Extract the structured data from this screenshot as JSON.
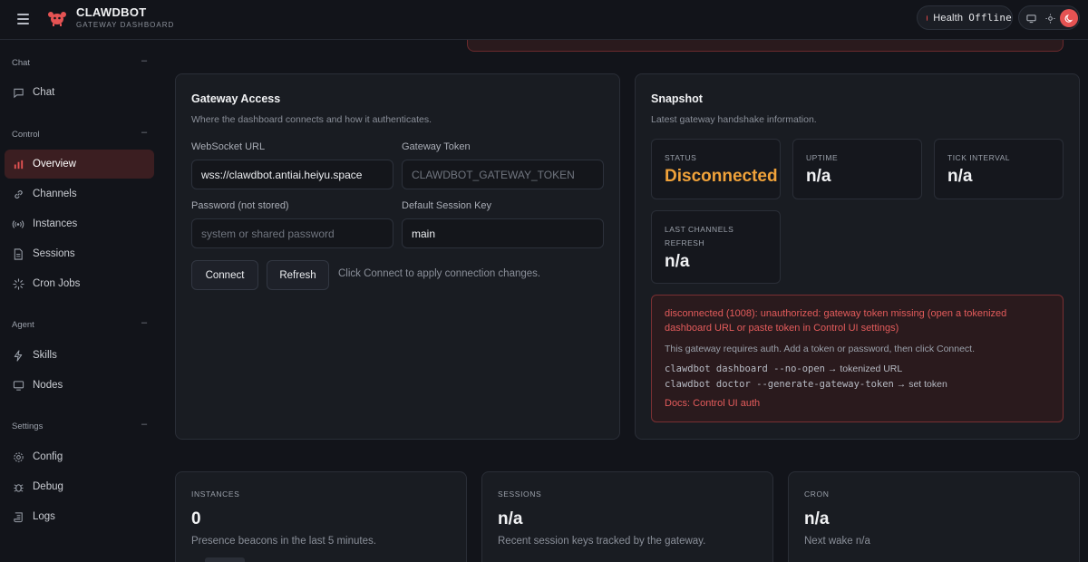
{
  "header": {
    "brand_title": "CLAWDBOT",
    "brand_subtitle": "GATEWAY DASHBOARD",
    "health_label": "Health",
    "health_status": "Offline",
    "accent_color": "#e55353"
  },
  "sidebar": {
    "groups": [
      {
        "label": "Chat",
        "toggle": "–",
        "items": [
          {
            "label": "Chat",
            "icon": "chat-bubble-icon"
          }
        ]
      },
      {
        "label": "Control",
        "toggle": "–",
        "items": [
          {
            "label": "Overview",
            "icon": "bar-chart-icon",
            "active": true
          },
          {
            "label": "Channels",
            "icon": "link-icon"
          },
          {
            "label": "Instances",
            "icon": "broadcast-icon"
          },
          {
            "label": "Sessions",
            "icon": "document-icon"
          },
          {
            "label": "Cron Jobs",
            "icon": "loader-icon"
          }
        ]
      },
      {
        "label": "Agent",
        "toggle": "–",
        "items": [
          {
            "label": "Skills",
            "icon": "bolt-icon"
          },
          {
            "label": "Nodes",
            "icon": "monitor-icon"
          }
        ]
      },
      {
        "label": "Settings",
        "toggle": "–",
        "items": [
          {
            "label": "Config",
            "icon": "gear-icon"
          },
          {
            "label": "Debug",
            "icon": "bug-icon"
          },
          {
            "label": "Logs",
            "icon": "scroll-icon"
          }
        ]
      }
    ]
  },
  "gateway_access": {
    "title": "Gateway Access",
    "subtitle": "Where the dashboard connects and how it authenticates.",
    "websocket_label": "WebSocket URL",
    "websocket_value": "wss://clawdbot.antiai.heiyu.space",
    "token_label": "Gateway Token",
    "token_placeholder": "CLAWDBOT_GATEWAY_TOKEN",
    "password_label": "Password (not stored)",
    "password_placeholder": "system or shared password",
    "session_key_label": "Default Session Key",
    "session_key_value": "main",
    "connect_label": "Connect",
    "refresh_label": "Refresh",
    "hint": "Click Connect to apply connection changes."
  },
  "snapshot": {
    "title": "Snapshot",
    "subtitle": "Latest gateway handshake information.",
    "stats": {
      "status_label": "STATUS",
      "status_value": "Disconnected",
      "uptime_label": "UPTIME",
      "uptime_value": "n/a",
      "tick_label": "TICK INTERVAL",
      "tick_value": "n/a",
      "refresh_label_1": "LAST CHANNELS",
      "refresh_label_2": "REFRESH",
      "refresh_value": "n/a"
    },
    "error": {
      "message": "disconnected (1008): unauthorized: gateway token missing (open a tokenized dashboard URL or paste token in Control UI settings)",
      "note": "This gateway requires auth. Add a token or password, then click Connect.",
      "cmd1": "clawdbot dashboard --no-open",
      "cmd1_arrow": " → ",
      "cmd1_desc": "tokenized URL",
      "cmd2": "clawdbot doctor --generate-gateway-token",
      "cmd2_arrow": " → ",
      "cmd2_desc": "set token",
      "link": "Docs: Control UI auth"
    }
  },
  "summary": {
    "instances_label": "INSTANCES",
    "instances_value": "0",
    "instances_note": "Presence beacons in the last 5 minutes.",
    "sessions_label": "SESSIONS",
    "sessions_value": "n/a",
    "sessions_note": "Recent session keys tracked by the gateway.",
    "cron_label": "CRON",
    "cron_value": "n/a",
    "cron_note": "Next wake n/a"
  }
}
